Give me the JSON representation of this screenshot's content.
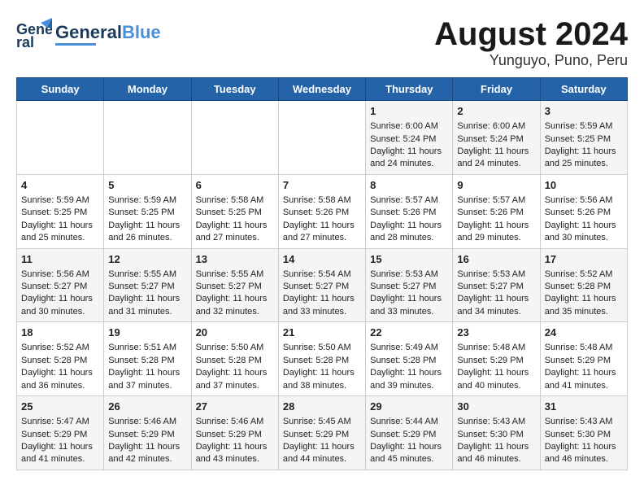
{
  "header": {
    "logo_general": "General",
    "logo_blue": "Blue",
    "month_title": "August 2024",
    "location": "Yunguyo, Puno, Peru"
  },
  "days_of_week": [
    "Sunday",
    "Monday",
    "Tuesday",
    "Wednesday",
    "Thursday",
    "Friday",
    "Saturday"
  ],
  "weeks": [
    [
      {
        "day": "",
        "sunrise": "",
        "sunset": "",
        "daylight": ""
      },
      {
        "day": "",
        "sunrise": "",
        "sunset": "",
        "daylight": ""
      },
      {
        "day": "",
        "sunrise": "",
        "sunset": "",
        "daylight": ""
      },
      {
        "day": "",
        "sunrise": "",
        "sunset": "",
        "daylight": ""
      },
      {
        "day": "1",
        "sunrise": "Sunrise: 6:00 AM",
        "sunset": "Sunset: 5:24 PM",
        "daylight": "Daylight: 11 hours and 24 minutes."
      },
      {
        "day": "2",
        "sunrise": "Sunrise: 6:00 AM",
        "sunset": "Sunset: 5:24 PM",
        "daylight": "Daylight: 11 hours and 24 minutes."
      },
      {
        "day": "3",
        "sunrise": "Sunrise: 5:59 AM",
        "sunset": "Sunset: 5:25 PM",
        "daylight": "Daylight: 11 hours and 25 minutes."
      }
    ],
    [
      {
        "day": "4",
        "sunrise": "Sunrise: 5:59 AM",
        "sunset": "Sunset: 5:25 PM",
        "daylight": "Daylight: 11 hours and 25 minutes."
      },
      {
        "day": "5",
        "sunrise": "Sunrise: 5:59 AM",
        "sunset": "Sunset: 5:25 PM",
        "daylight": "Daylight: 11 hours and 26 minutes."
      },
      {
        "day": "6",
        "sunrise": "Sunrise: 5:58 AM",
        "sunset": "Sunset: 5:25 PM",
        "daylight": "Daylight: 11 hours and 27 minutes."
      },
      {
        "day": "7",
        "sunrise": "Sunrise: 5:58 AM",
        "sunset": "Sunset: 5:26 PM",
        "daylight": "Daylight: 11 hours and 27 minutes."
      },
      {
        "day": "8",
        "sunrise": "Sunrise: 5:57 AM",
        "sunset": "Sunset: 5:26 PM",
        "daylight": "Daylight: 11 hours and 28 minutes."
      },
      {
        "day": "9",
        "sunrise": "Sunrise: 5:57 AM",
        "sunset": "Sunset: 5:26 PM",
        "daylight": "Daylight: 11 hours and 29 minutes."
      },
      {
        "day": "10",
        "sunrise": "Sunrise: 5:56 AM",
        "sunset": "Sunset: 5:26 PM",
        "daylight": "Daylight: 11 hours and 30 minutes."
      }
    ],
    [
      {
        "day": "11",
        "sunrise": "Sunrise: 5:56 AM",
        "sunset": "Sunset: 5:27 PM",
        "daylight": "Daylight: 11 hours and 30 minutes."
      },
      {
        "day": "12",
        "sunrise": "Sunrise: 5:55 AM",
        "sunset": "Sunset: 5:27 PM",
        "daylight": "Daylight: 11 hours and 31 minutes."
      },
      {
        "day": "13",
        "sunrise": "Sunrise: 5:55 AM",
        "sunset": "Sunset: 5:27 PM",
        "daylight": "Daylight: 11 hours and 32 minutes."
      },
      {
        "day": "14",
        "sunrise": "Sunrise: 5:54 AM",
        "sunset": "Sunset: 5:27 PM",
        "daylight": "Daylight: 11 hours and 33 minutes."
      },
      {
        "day": "15",
        "sunrise": "Sunrise: 5:53 AM",
        "sunset": "Sunset: 5:27 PM",
        "daylight": "Daylight: 11 hours and 33 minutes."
      },
      {
        "day": "16",
        "sunrise": "Sunrise: 5:53 AM",
        "sunset": "Sunset: 5:27 PM",
        "daylight": "Daylight: 11 hours and 34 minutes."
      },
      {
        "day": "17",
        "sunrise": "Sunrise: 5:52 AM",
        "sunset": "Sunset: 5:28 PM",
        "daylight": "Daylight: 11 hours and 35 minutes."
      }
    ],
    [
      {
        "day": "18",
        "sunrise": "Sunrise: 5:52 AM",
        "sunset": "Sunset: 5:28 PM",
        "daylight": "Daylight: 11 hours and 36 minutes."
      },
      {
        "day": "19",
        "sunrise": "Sunrise: 5:51 AM",
        "sunset": "Sunset: 5:28 PM",
        "daylight": "Daylight: 11 hours and 37 minutes."
      },
      {
        "day": "20",
        "sunrise": "Sunrise: 5:50 AM",
        "sunset": "Sunset: 5:28 PM",
        "daylight": "Daylight: 11 hours and 37 minutes."
      },
      {
        "day": "21",
        "sunrise": "Sunrise: 5:50 AM",
        "sunset": "Sunset: 5:28 PM",
        "daylight": "Daylight: 11 hours and 38 minutes."
      },
      {
        "day": "22",
        "sunrise": "Sunrise: 5:49 AM",
        "sunset": "Sunset: 5:28 PM",
        "daylight": "Daylight: 11 hours and 39 minutes."
      },
      {
        "day": "23",
        "sunrise": "Sunrise: 5:48 AM",
        "sunset": "Sunset: 5:29 PM",
        "daylight": "Daylight: 11 hours and 40 minutes."
      },
      {
        "day": "24",
        "sunrise": "Sunrise: 5:48 AM",
        "sunset": "Sunset: 5:29 PM",
        "daylight": "Daylight: 11 hours and 41 minutes."
      }
    ],
    [
      {
        "day": "25",
        "sunrise": "Sunrise: 5:47 AM",
        "sunset": "Sunset: 5:29 PM",
        "daylight": "Daylight: 11 hours and 41 minutes."
      },
      {
        "day": "26",
        "sunrise": "Sunrise: 5:46 AM",
        "sunset": "Sunset: 5:29 PM",
        "daylight": "Daylight: 11 hours and 42 minutes."
      },
      {
        "day": "27",
        "sunrise": "Sunrise: 5:46 AM",
        "sunset": "Sunset: 5:29 PM",
        "daylight": "Daylight: 11 hours and 43 minutes."
      },
      {
        "day": "28",
        "sunrise": "Sunrise: 5:45 AM",
        "sunset": "Sunset: 5:29 PM",
        "daylight": "Daylight: 11 hours and 44 minutes."
      },
      {
        "day": "29",
        "sunrise": "Sunrise: 5:44 AM",
        "sunset": "Sunset: 5:29 PM",
        "daylight": "Daylight: 11 hours and 45 minutes."
      },
      {
        "day": "30",
        "sunrise": "Sunrise: 5:43 AM",
        "sunset": "Sunset: 5:30 PM",
        "daylight": "Daylight: 11 hours and 46 minutes."
      },
      {
        "day": "31",
        "sunrise": "Sunrise: 5:43 AM",
        "sunset": "Sunset: 5:30 PM",
        "daylight": "Daylight: 11 hours and 46 minutes."
      }
    ]
  ]
}
